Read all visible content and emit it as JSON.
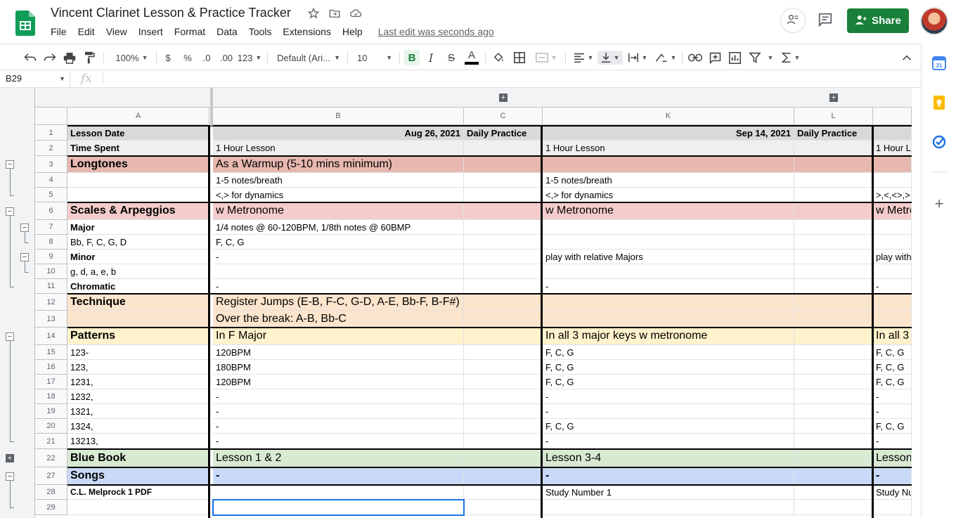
{
  "app": {
    "title": "Vincent Clarinet Lesson & Practice Tracker",
    "last_edit": "Last edit was seconds ago",
    "share_label": "Share",
    "brand_color": "#188038"
  },
  "menu": [
    "File",
    "Edit",
    "View",
    "Insert",
    "Format",
    "Data",
    "Tools",
    "Extensions",
    "Help"
  ],
  "toolbar": {
    "zoom": "100%",
    "currency": "$",
    "percent": "%",
    "decrease_decimal": ".0",
    "increase_decimal": ".00",
    "number_format": "123",
    "font": "Default (Ari...",
    "font_size": "10",
    "bold": "B",
    "italic": "I",
    "strikethrough": "S",
    "text_color": "A"
  },
  "formula_bar": {
    "cell_ref": "B29",
    "fx": "fx"
  },
  "columns": [
    {
      "letter": "A",
      "width": 203
    },
    {
      "letter": "B",
      "width": 357
    },
    {
      "letter": "C",
      "width": 112
    },
    {
      "letter": "K",
      "width": 358
    },
    {
      "letter": "L",
      "width": 112
    },
    {
      "letter": "",
      "width": 55
    }
  ],
  "rows": [
    {
      "num": "1",
      "cells": [
        "Lesson Date",
        "Aug 26, 2021",
        "Daily Practice",
        "Sep 14, 2021",
        "Daily Practice",
        ""
      ]
    },
    {
      "num": "2",
      "cells": [
        "Time Spent",
        "1 Hour Lesson",
        "",
        "1 Hour Lesson",
        "",
        "1 Hour L"
      ]
    },
    {
      "num": "3",
      "cells": [
        "Longtones",
        "As a Warmup (5-10 mins minimum)",
        "",
        "",
        "",
        ""
      ]
    },
    {
      "num": "4",
      "cells": [
        "",
        "1-5 notes/breath",
        "",
        "1-5 notes/breath",
        "",
        ""
      ]
    },
    {
      "num": "5",
      "cells": [
        "",
        "<,> for dynamics",
        "",
        "<,> for dynamics",
        "",
        ">,<,<>,>"
      ]
    },
    {
      "num": "6",
      "cells": [
        "Scales & Arpeggios",
        "w Metronome",
        "",
        "w Metronome",
        "",
        "w Metro"
      ]
    },
    {
      "num": "7",
      "cells": [
        "Major",
        "1/4 notes @ 60-120BPM, 1/8th notes @ 60BMP",
        "",
        "",
        "",
        ""
      ]
    },
    {
      "num": "8",
      "cells": [
        "Bb, F, C, G, D",
        "F, C, G",
        "",
        "",
        "",
        ""
      ]
    },
    {
      "num": "9",
      "cells": [
        "Minor",
        "-",
        "",
        "play with relative Majors",
        "",
        "play with"
      ]
    },
    {
      "num": "10",
      "cells": [
        "g, d, a, e, b",
        "",
        "",
        "",
        "",
        ""
      ]
    },
    {
      "num": "11",
      "cells": [
        "Chromatic",
        "-",
        "",
        "-",
        "",
        "-"
      ]
    },
    {
      "num": "12",
      "cells": [
        "Technique",
        "Register Jumps (E-B, F-C, G-D, A-E, Bb-F, B-F#)",
        "",
        "",
        "",
        ""
      ]
    },
    {
      "num": "13",
      "cells": [
        "",
        "Over the break: A-B, Bb-C",
        "",
        "",
        "",
        ""
      ]
    },
    {
      "num": "14",
      "cells": [
        "Patterns",
        "In F Major",
        "",
        "In all 3 major keys w metronome",
        "",
        "In all 3"
      ]
    },
    {
      "num": "15",
      "cells": [
        "123-",
        "120BPM",
        "",
        "F, C, G",
        "",
        "F, C, G"
      ]
    },
    {
      "num": "16",
      "cells": [
        "123,",
        "180BPM",
        "",
        "F, C, G",
        "",
        "F, C, G"
      ]
    },
    {
      "num": "17",
      "cells": [
        "1231,",
        "120BPM",
        "",
        "F, C, G",
        "",
        "F, C, G"
      ]
    },
    {
      "num": "18",
      "cells": [
        "1232,",
        "-",
        "",
        "-",
        "",
        "-"
      ]
    },
    {
      "num": "19",
      "cells": [
        "1321,",
        "-",
        "",
        "-",
        "",
        "-"
      ]
    },
    {
      "num": "20",
      "cells": [
        "1324,",
        "-",
        "",
        "F, C, G",
        "",
        "F, C, G"
      ]
    },
    {
      "num": "21",
      "cells": [
        "13213,",
        "-",
        "",
        "-",
        "",
        "-"
      ]
    },
    {
      "num": "22",
      "cells": [
        "Blue Book",
        "Lesson 1 & 2",
        "",
        "Lesson 3-4",
        "",
        "Lesson"
      ]
    },
    {
      "num": "27",
      "cells": [
        "Songs",
        "-",
        "",
        "-",
        "",
        "-"
      ]
    },
    {
      "num": "28",
      "cells": [
        "C.L. Melprock 1 PDF",
        "",
        "",
        "Study Number 1",
        "",
        "Study Nu"
      ]
    },
    {
      "num": "29",
      "cells": [
        "",
        "",
        "",
        "",
        "",
        ""
      ]
    }
  ],
  "colors": {
    "longtones": "#e6b8af",
    "scales": "#f4cccc",
    "technique": "#fce5cd",
    "patterns": "#fff2cc",
    "bluebook": "#d9ead3",
    "songs": "#c9daf8",
    "header_gray": "#d9d9d9",
    "light_gray": "#efefef",
    "selection": "#1a73e8"
  }
}
